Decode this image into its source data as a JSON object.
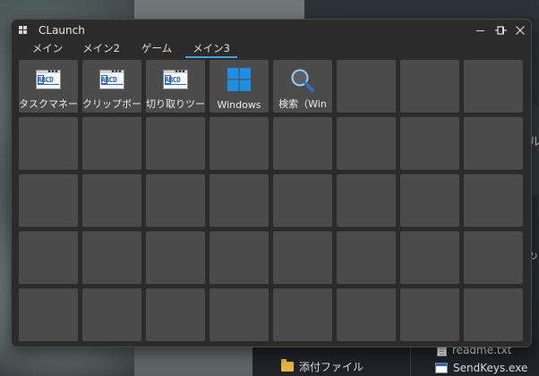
{
  "window": {
    "title": "CLaunch",
    "pin_glyph": "⊶",
    "close_glyph": "✕"
  },
  "tabs": [
    {
      "label": "メイン",
      "active": false
    },
    {
      "label": "メイン2",
      "active": false
    },
    {
      "label": "ゲーム",
      "active": false
    },
    {
      "label": "メイン3",
      "active": true
    }
  ],
  "buttons": [
    {
      "label": "タスクマネー",
      "icon": "app-window-icon",
      "icon_text": "ABCD"
    },
    {
      "label": "クリップボー",
      "icon": "app-window-icon",
      "icon_text": "ABCD"
    },
    {
      "label": "切り取りツー",
      "icon": "app-window-icon",
      "icon_text": "ABCD"
    },
    {
      "label": "Windows",
      "icon": "windows-logo-icon"
    },
    {
      "label": "検索（Win",
      "icon": "search-icon"
    }
  ],
  "grid": {
    "columns": 8,
    "rows": 5
  },
  "background": {
    "right_edge_glyph_1": "ル",
    "right_edge_glyph_2": "↻",
    "explorer": {
      "folder_label": "添付ファイル",
      "file_1": "readme.txt",
      "file_2": "SendKeys.exe"
    }
  },
  "colors": {
    "cell": "#4b4b4b",
    "window": "#2b2b2b",
    "accent": "#4a9fe0",
    "windows_logo": "#1f8fe3"
  }
}
